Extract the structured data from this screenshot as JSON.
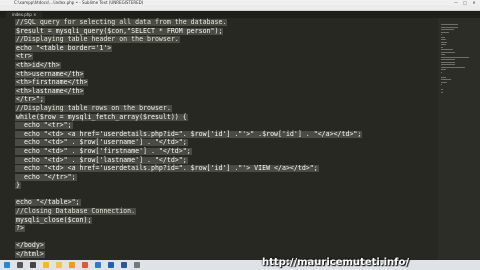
{
  "window": {
    "title": "C:\\xampp\\htdocs\\...\\index.php • - Sublime Text (UNREGISTERED)",
    "controls": [
      "—",
      "□",
      "✕"
    ]
  },
  "menubar": [
    "File",
    "Edit",
    "Selection",
    "Find",
    "View",
    "Goto",
    "Tools",
    "Project",
    "Preferences",
    "Help"
  ],
  "tab": {
    "label": "index.php ×"
  },
  "code_lines": [
    "//SQL query for selecting all data from the database.",
    "$result = mysqli_query($con,\"SELECT * FROM person\");",
    "//Displaying table header on the browser.",
    "echo \"<table border='1'>",
    "<tr>",
    "<th>id</th>",
    "<th>username</th>",
    "<th>firstname</th>",
    "<th>lastname</th>",
    "</tr>\";",
    "//Displaying table rows on the browser.",
    "while($row = mysqli_fetch_array($result)) {",
    "  echo \"<tr>\";",
    "  echo \"<td> <a href='userdetails.php?id=\". $row['id'] .\"'>\" .$row['id'] . \"</a></td>\";",
    "  echo \"<td>\" . $row['username'] . \"</td>\";",
    "  echo \"<td>\" . $row['firstname'] . \"</td>\";",
    "  echo \"<td>\" . $row['lastname'] . \"</td>\";",
    "  echo \"<td> <a href='userdetails.php?id=\". $row['id'] .\"'> VIEW </a></td>\";",
    "  echo \"</tr>\";",
    "}",
    "",
    "echo \"</table>\";",
    "//Closing Database Connection.",
    "mysqli_close($con);",
    "?>",
    "",
    "</body>",
    "</html>"
  ],
  "overlay": {
    "url": "http://mauricemuteti.info/"
  },
  "colors": {
    "editor_bg": "#272822",
    "selection": "#4a4b44",
    "taskbar": "#dfe3e8",
    "text": "#f8f8f2"
  },
  "taskbar": {
    "icons": [
      "windows-start-icon",
      "search-icon",
      "task-view-icon",
      "chrome-icon",
      "folder-icon",
      "sublime-icon",
      "firefox-icon",
      "edge-icon",
      "mail-icon",
      "word-icon",
      "settings-icon"
    ]
  }
}
